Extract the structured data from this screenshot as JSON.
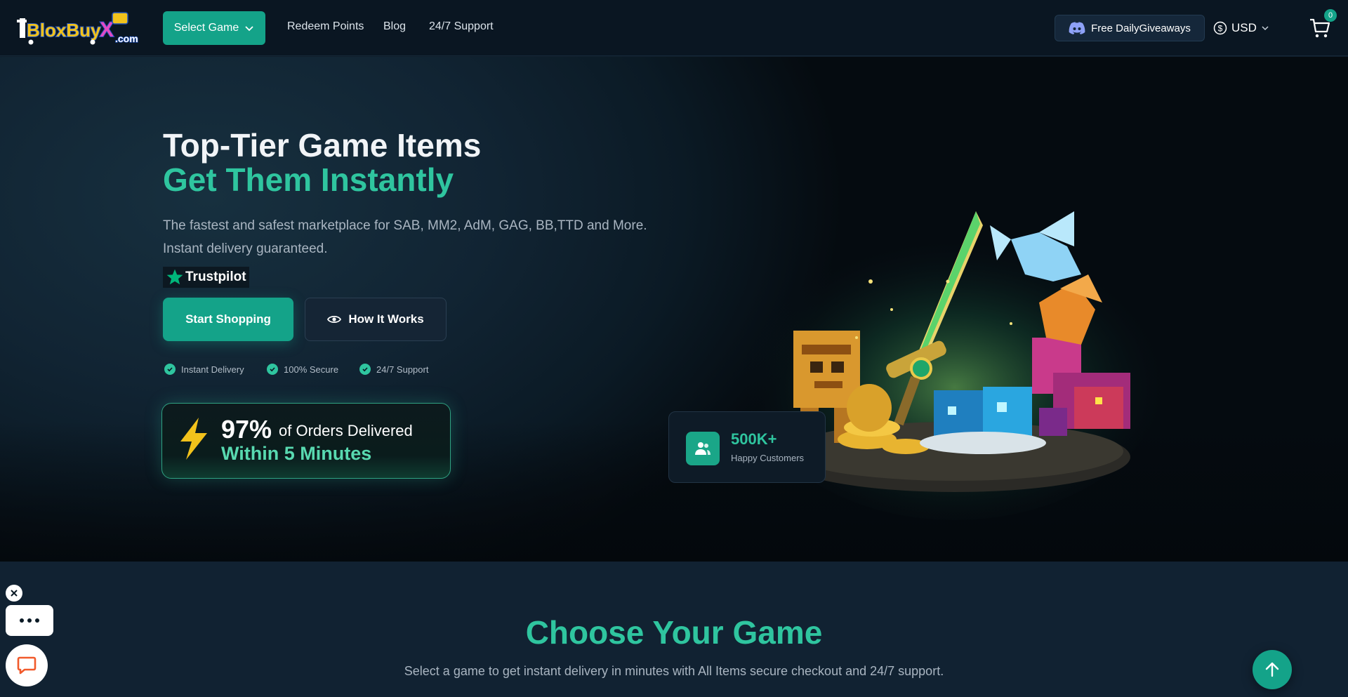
{
  "nav": {
    "logo_alt": "BloxBuyx.com",
    "select_game": "Select Game",
    "links": [
      "Redeem Points",
      "Blog",
      "24/7 Support"
    ],
    "discord_label": "Free DailyGiveaways",
    "currency": "USD",
    "cart_count": "0"
  },
  "hero": {
    "title_line1": "Top-Tier Game Items",
    "title_line2": "Get Them Instantly",
    "subtitle": "The fastest and safest marketplace for SAB, MM2, AdM, GAG, BB,TTD and More. Instant delivery guaranteed.",
    "trustpilot": "Trustpilot",
    "start_button": "Start Shopping",
    "how_button": "How It Works",
    "features": [
      "Instant Delivery",
      "100% Secure",
      "24/7 Support"
    ],
    "delivery_pct": "97%",
    "delivery_of": "of Orders Delivered",
    "delivery_within": "Within 5 Minutes",
    "customers_num": "500K+",
    "customers_label": "Happy Customers"
  },
  "section": {
    "title": "Choose Your Game",
    "subtitle": "Select a game to get instant delivery in minutes with All Items secure checkout and 24/7 support."
  },
  "colors": {
    "accent": "#14a389",
    "accent_text": "#2fc59f",
    "nav_bg": "#0a1622",
    "page_bg": "#0f1d2a"
  }
}
